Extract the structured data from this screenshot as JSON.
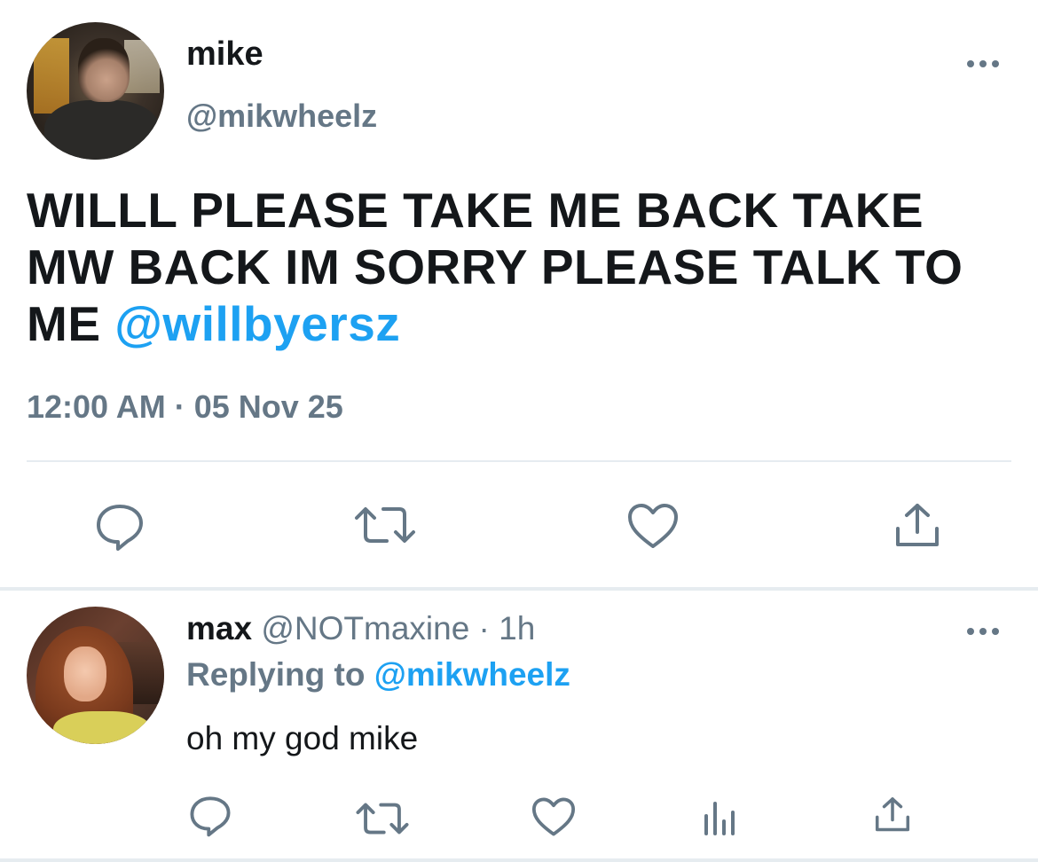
{
  "main_tweet": {
    "name": "mike",
    "handle": "@mikwheelz",
    "text": "WILLL PLEASE TAKE ME BACK TAKE MW BACK IM SORRY PLEASE TALK TO ME ",
    "mention": "@willbyersz",
    "timestamp": "12:00 AM · 05 Nov 25",
    "actions": [
      "reply-icon",
      "retweet-icon",
      "like-icon",
      "share-icon"
    ]
  },
  "reply_tweet": {
    "name": "max",
    "meta": " @NOTmaxine · 1h",
    "replying_prefix": "Replying to ",
    "replying_handle": "@mikwheelz",
    "text": "oh my god mike",
    "actions": [
      "reply-icon",
      "retweet-icon",
      "like-icon",
      "analytics-icon",
      "share-icon"
    ]
  },
  "colors": {
    "text": "#14171a",
    "secondary": "#657786",
    "accent": "#1da1f2",
    "divider": "#e6ecf0"
  }
}
